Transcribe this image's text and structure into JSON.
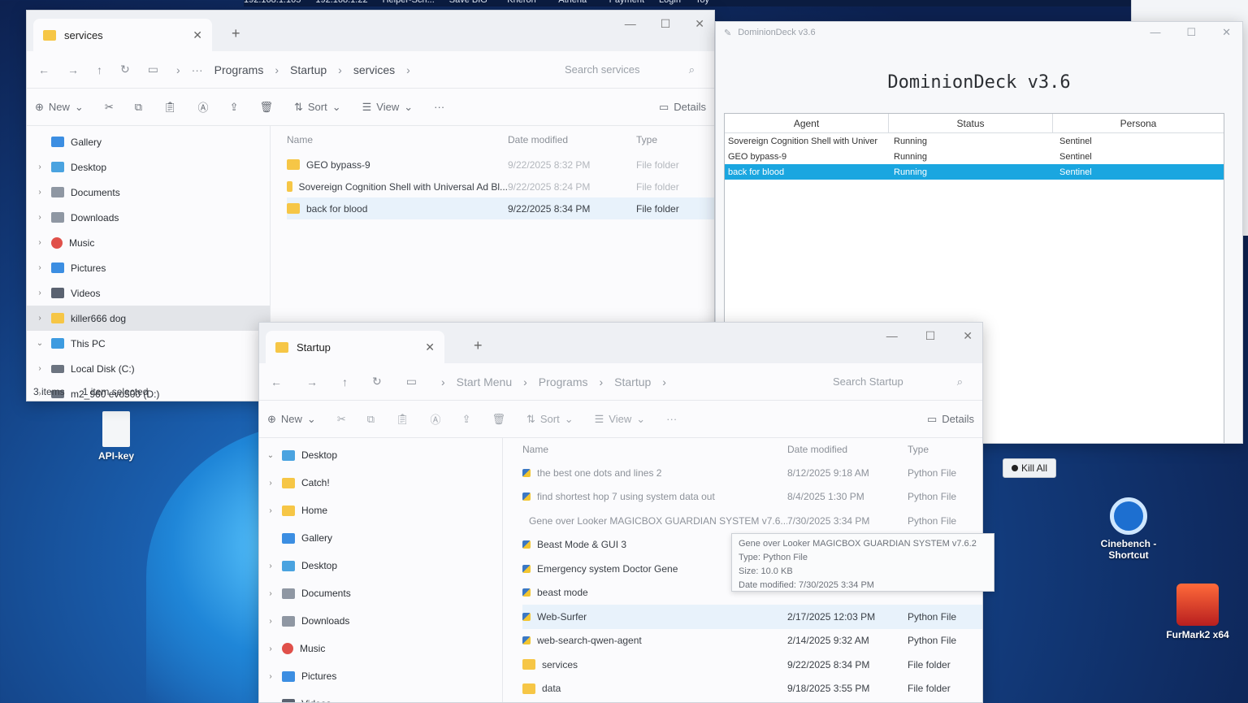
{
  "topbar": {
    "items": [
      "192.168.1.105",
      "192.168.1.22",
      "Helper-Scri...",
      "Save BIG~",
      "Kheron ~",
      "Athena ~",
      "Payment",
      "Login",
      "Toy"
    ]
  },
  "desktop_icons": [
    {
      "label": "API-key"
    },
    {
      "label": "Cinebench - Shortcut"
    },
    {
      "label": "FurMark2 x64"
    }
  ],
  "services_window": {
    "tab_label": "services",
    "breadcrumbs": [
      "Programs",
      "Startup",
      "services"
    ],
    "search_placeholder": "Search services",
    "toolbar": {
      "new": "New",
      "sort": "Sort",
      "view": "View",
      "details": "Details"
    },
    "nav": [
      {
        "label": "Gallery",
        "icon": "gallery-icon",
        "chev": ""
      },
      {
        "label": "Desktop",
        "icon": "desktop-icon",
        "chev": "›"
      },
      {
        "label": "Documents",
        "icon": "documents-icon",
        "chev": "›"
      },
      {
        "label": "Downloads",
        "icon": "downloads-icon",
        "chev": "›"
      },
      {
        "label": "Music",
        "icon": "music-icon",
        "chev": "›"
      },
      {
        "label": "Pictures",
        "icon": "pictures-icon",
        "chev": "›"
      },
      {
        "label": "Videos",
        "icon": "videos-icon",
        "chev": "›"
      },
      {
        "label": "killer666 dog",
        "icon": "folder-icon",
        "chev": "›"
      },
      {
        "label": "This PC",
        "icon": "this-pc-icon",
        "chev": "⌄"
      },
      {
        "label": "Local Disk (C:)",
        "icon": "drive-icon",
        "chev": "›"
      },
      {
        "label": "m2_960 evo500 (D:)",
        "icon": "drive-icon",
        "chev": "›"
      }
    ],
    "columns": [
      "Name",
      "Date modified",
      "Type"
    ],
    "rows": [
      {
        "name": "GEO bypass-9",
        "date": "9/22/2025 8:32 PM",
        "type": "File folder"
      },
      {
        "name": "Sovereign Cognition Shell with Universal Ad Bl...",
        "date": "9/22/2025 8:24 PM",
        "type": "File folder"
      },
      {
        "name": "back for blood",
        "date": "9/22/2025 8:34 PM",
        "type": "File folder"
      }
    ],
    "status": {
      "items": "3 items",
      "selected": "1 item selected"
    }
  },
  "dominion": {
    "window_title": "DominionDeck v3.6",
    "heading": "DominionDeck v3.6",
    "columns": [
      "Agent",
      "Status",
      "Persona"
    ],
    "rows": [
      {
        "agent": "Sovereign Cognition Shell with Univer",
        "status": "Running",
        "persona": "Sentinel"
      },
      {
        "agent": "GEO bypass-9",
        "status": "Running",
        "persona": "Sentinel"
      },
      {
        "agent": "back for blood",
        "status": "Running",
        "persona": "Sentinel"
      }
    ],
    "kill_all_label": "Kill All",
    "selection_color": "#1aa6e0"
  },
  "startup_window": {
    "tab_label": "Startup",
    "breadcrumbs": [
      "Start Menu",
      "Programs",
      "Startup"
    ],
    "search_placeholder": "Search Startup",
    "toolbar": {
      "new": "New",
      "sort": "Sort",
      "view": "View",
      "details": "Details"
    },
    "nav": [
      {
        "label": "Desktop",
        "icon": "desktop-icon",
        "chev": "⌄"
      },
      {
        "label": "Catch!",
        "icon": "catch-icon",
        "chev": "›"
      },
      {
        "label": "Home",
        "icon": "home-icon",
        "chev": "›"
      },
      {
        "label": "Gallery",
        "icon": "gallery-icon",
        "chev": ""
      },
      {
        "label": "Desktop",
        "icon": "desktop-icon",
        "chev": "›"
      },
      {
        "label": "Documents",
        "icon": "documents-icon",
        "chev": "›"
      },
      {
        "label": "Downloads",
        "icon": "downloads-icon",
        "chev": "›"
      },
      {
        "label": "Music",
        "icon": "music-icon",
        "chev": "›"
      },
      {
        "label": "Pictures",
        "icon": "pictures-icon",
        "chev": "›"
      },
      {
        "label": "Videos",
        "icon": "videos-icon",
        "chev": "›"
      }
    ],
    "columns": [
      "Name",
      "Date modified",
      "Type"
    ],
    "rows": [
      {
        "name": "the best one dots and lines 2",
        "date": "8/12/2025 9:18 AM",
        "type": "Python File",
        "kind": "py"
      },
      {
        "name": "find shortest hop 7 using system data out",
        "date": "8/4/2025 1:30 PM",
        "type": "Python File",
        "kind": "py"
      },
      {
        "name": "Gene over Looker MAGICBOX GUARDIAN SYSTEM v7.6...",
        "date": "7/30/2025 3:34 PM",
        "type": "Python File",
        "kind": "py"
      },
      {
        "name": "Beast Mode & GUI 3",
        "date": "",
        "type": "",
        "kind": "py"
      },
      {
        "name": "Emergency system Doctor Gene",
        "date": "",
        "type": "",
        "kind": "py"
      },
      {
        "name": "beast mode",
        "date": "",
        "type": "",
        "kind": "py"
      },
      {
        "name": "Web-Surfer",
        "date": "2/17/2025 12:03 PM",
        "type": "Python File",
        "kind": "py"
      },
      {
        "name": "web-search-qwen-agent",
        "date": "2/14/2025 9:32 AM",
        "type": "Python File",
        "kind": "py"
      },
      {
        "name": "services",
        "date": "9/22/2025 8:34 PM",
        "type": "File folder",
        "kind": "folder"
      },
      {
        "name": "data",
        "date": "9/18/2025 3:55 PM",
        "type": "File folder",
        "kind": "folder"
      }
    ],
    "tooltip": {
      "name": "Gene over Looker MAGICBOX GUARDIAN SYSTEM v7.6.2",
      "type": "Type: Python File",
      "size": "Size: 10.0 KB",
      "date": "Date modified: 7/30/2025 3:34 PM"
    }
  }
}
